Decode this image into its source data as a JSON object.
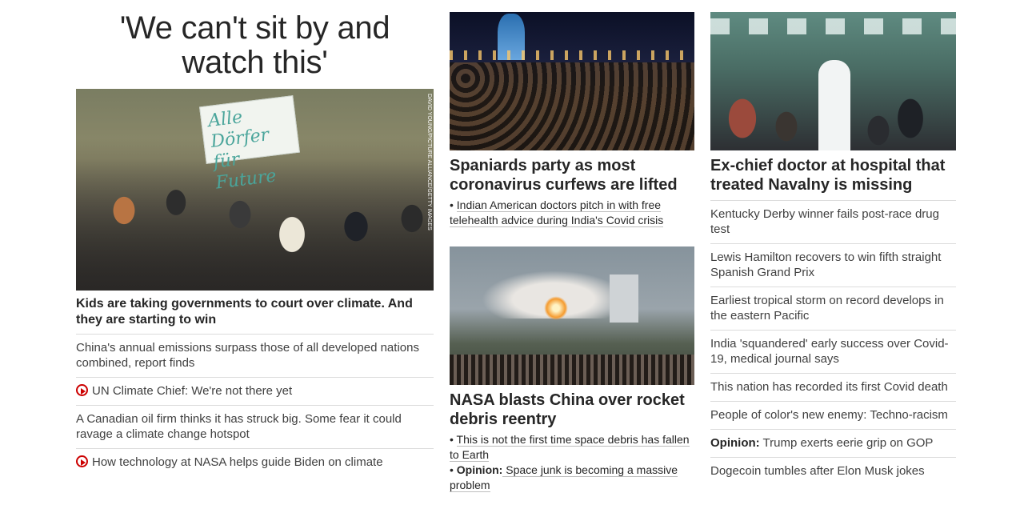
{
  "left": {
    "headline": "'We can't sit by and watch this'",
    "hero_sign_text": "Alle Dörfer für Future",
    "hero_credit": "DAVID YOUNG/PICTURE ALLIANCE/GETTY IMAGES",
    "hero_title": "Kids are taking governments to court over climate. And they are starting to win",
    "items": [
      {
        "text": "China's annual emissions surpass those of all developed nations combined, report finds"
      },
      {
        "text": "UN Climate Chief: We're not there yet",
        "icon": "play-video-icon"
      },
      {
        "text": "A Canadian oil firm thinks it has struck big. Some fear it could ravage a climate change hotspot"
      },
      {
        "text": "How technology at NASA helps guide Biden on climate",
        "icon": "play-video-icon"
      }
    ]
  },
  "middle": {
    "story1": {
      "title": "Spaniards party as most coronavirus curfews are lifted",
      "links": [
        {
          "prefix": "• ",
          "label": "",
          "text": "Indian American doctors pitch in with free telehealth advice during India's Covid crisis"
        }
      ]
    },
    "story2": {
      "title": "NASA blasts China over rocket debris reentry",
      "links": [
        {
          "prefix": "• ",
          "label": "",
          "text": "This is not the first time space debris has fallen to Earth"
        },
        {
          "prefix": "• ",
          "label": "Opinion:",
          "text": " Space junk is becoming a massive problem"
        }
      ]
    }
  },
  "right": {
    "title": "Ex-chief doctor at hospital that treated Navalny is missing",
    "items": [
      {
        "label": "",
        "text": "Kentucky Derby winner fails post-race drug test"
      },
      {
        "label": "",
        "text": "Lewis Hamilton recovers to win fifth straight Spanish Grand Prix"
      },
      {
        "label": "",
        "text": "Earliest tropical storm on record develops in the eastern Pacific"
      },
      {
        "label": "",
        "text": "India 'squandered' early success over Covid-19, medical journal says"
      },
      {
        "label": "",
        "text": "This nation has recorded its first Covid death"
      },
      {
        "label": "",
        "text": "People of color's new enemy: Techno-racism"
      },
      {
        "label": "Opinion:",
        "text": " Trump exerts eerie grip on GOP"
      },
      {
        "label": "",
        "text": "Dogecoin tumbles after Elon Musk jokes"
      }
    ]
  },
  "colors": {
    "text": "#262626",
    "divider": "#dcdcdc",
    "video_icon": "#cc0000"
  }
}
